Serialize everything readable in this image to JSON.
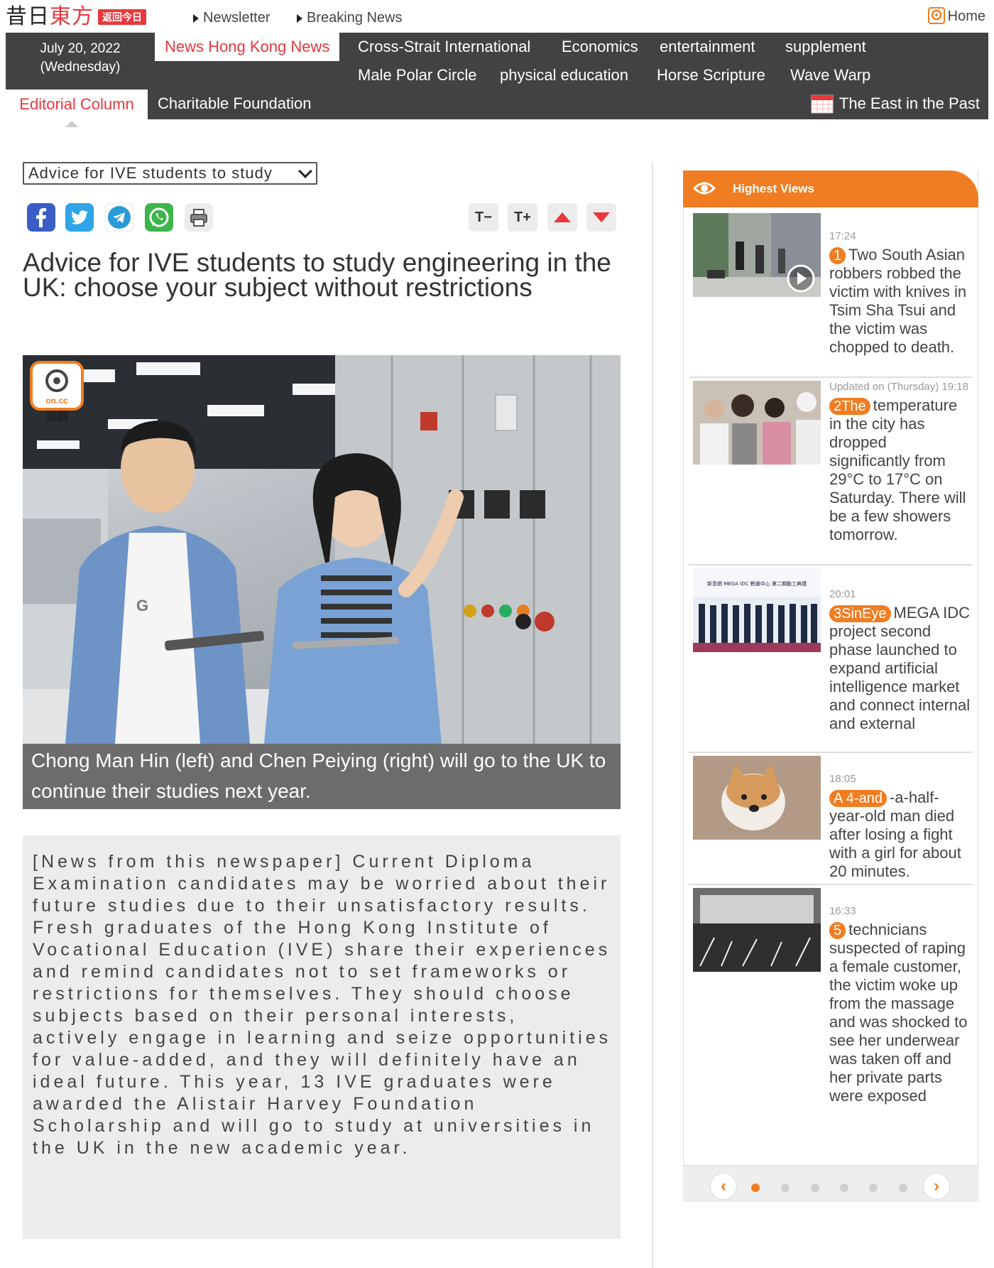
{
  "topbar": {
    "logo_cn": "昔日",
    "logo_cn2": "東方",
    "logo_badge": "返回今日",
    "newsletter": "Newsletter",
    "breaking": "Breaking News",
    "home": "Home"
  },
  "nav": {
    "date_line1": "July 20, 2022",
    "date_line2": "(Wednesday)",
    "row1": [
      "News Hong Kong News",
      "Cross-Strait International",
      "Economics",
      "entertainment",
      "supplement"
    ],
    "row2": [
      "Male Polar Circle",
      "physical education",
      "Horse Scripture",
      "Wave Warp"
    ],
    "row3_active": "Editorial Column",
    "row3_other": "Charitable Foundation",
    "past": "The East in the Past"
  },
  "article": {
    "select_value": "Advice for IVE students to study",
    "headline": "Advice for IVE students to study engineering in the UK: choose your subject without restrictions",
    "photo_logo": "on.cc",
    "photo_logo_cn": "東網",
    "caption": "Chong Man Hin (left) and Chen Peiying (right) will go to the UK to continue their studies next year.",
    "body": "[News from this newspaper] Current Diploma Examination candidates may be worried about their future studies due to their unsatisfactory results. Fresh graduates of the Hong Kong Institute of Vocational Education (IVE) share their experiences and remind candidates not to set frameworks or restrictions for themselves. They should choose subjects based on their personal interests, actively engage in learning and seize opportunities for value-added, and they will definitely have an ideal future. This year, 13 IVE graduates were awarded the Alistair Harvey Foundation Scholarship and will go to study at universities in the UK in the new academic year."
  },
  "tools": {
    "font_smaller": "T−",
    "font_larger": "T+"
  },
  "highest_views": {
    "title": "Highest Views",
    "items": [
      {
        "time": "17:24",
        "rank": "1",
        "title": "Two South Asian robbers robbed the victim with knives in Tsim Sha Tsui and the victim was chopped to death."
      },
      {
        "time": "Updated on (Thursday) 19:18",
        "rank": "2The",
        "title": "temperature in the city has dropped significantly from 29°C to 17°C on Saturday. There will be a few showers tomorrow."
      },
      {
        "time": "20:01",
        "rank": "3SinEye",
        "title": "MEGA IDC project second phase launched to expand artificial intelligence market and connect internal and external"
      },
      {
        "time": "18:05",
        "rank": "A 4-and",
        "title": "-a-half-year-old man died after losing a fight with a girl for about 20 minutes."
      },
      {
        "time": "16:33",
        "rank": "5",
        "title": "technicians suspected of raping a female customer, the victim woke up from the massage and was shocked to see her underwear was taken off and her private parts were exposed"
      }
    ],
    "thumb3_text": "新意網 MEGA IDC 數據中心 第二期動工典禮"
  },
  "colors": {
    "accent_red": "#e8383d",
    "nav_bg": "#424242",
    "orange": "#f07d21"
  }
}
